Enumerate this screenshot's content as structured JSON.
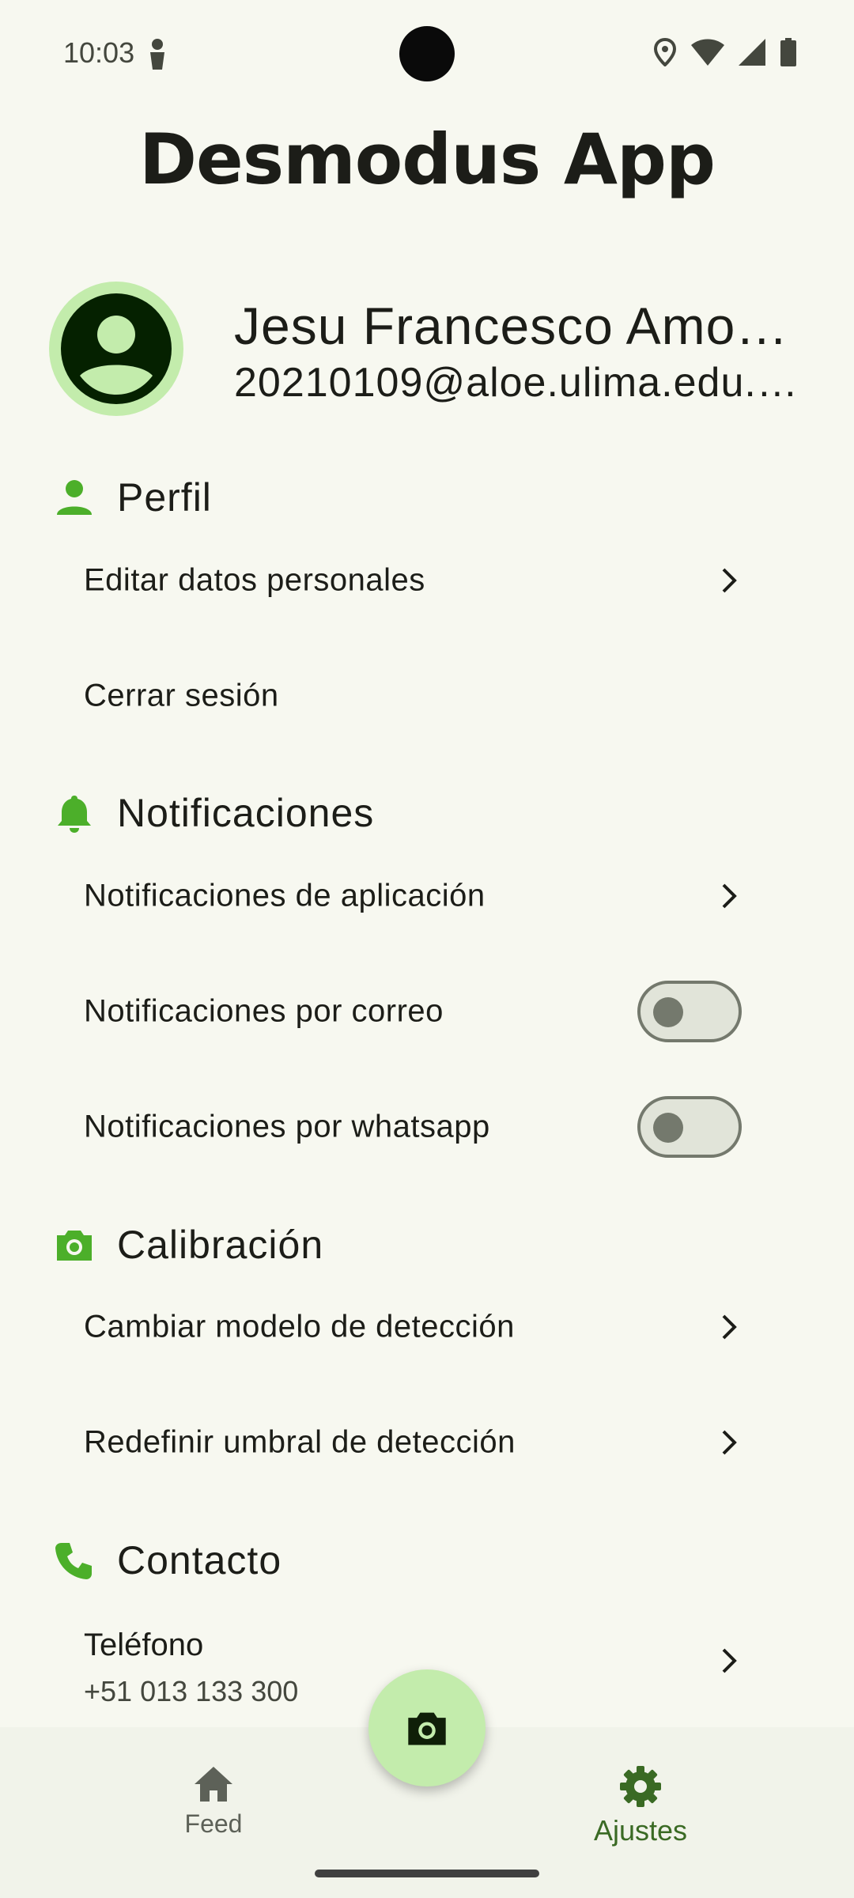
{
  "status_bar": {
    "time": "10:03"
  },
  "app": {
    "title": "Desmodus App"
  },
  "profile": {
    "name": "Jesu Francesco Amo…",
    "email": "20210109@aloe.ulima.edu.…"
  },
  "sections": {
    "perfil": {
      "title": "Perfil",
      "items": [
        "Editar datos personales",
        "Cerrar sesión"
      ]
    },
    "notificaciones": {
      "title": "Notificaciones",
      "items": [
        "Notificaciones de aplicación",
        "Notificaciones por correo",
        "Notificaciones por whatsapp"
      ],
      "toggles": {
        "correo": false,
        "whatsapp": false
      }
    },
    "calibracion": {
      "title": "Calibración",
      "items": [
        "Cambiar modelo de detección",
        "Redefinir umbral de detección"
      ]
    },
    "contacto": {
      "title": "Contacto",
      "phone_label": "Teléfono",
      "phone_value": "+51 013 133 300"
    }
  },
  "nav": {
    "feed": "Feed",
    "ajustes": "Ajustes",
    "active": "ajustes"
  },
  "icons": {
    "status": [
      "person-icon",
      "location-icon",
      "wifi-icon",
      "signal-icon",
      "battery-icon"
    ],
    "sections": [
      "person-icon",
      "bell-icon",
      "camera-icon",
      "phone-icon"
    ],
    "fab": "camera-icon",
    "nav": [
      "home-icon",
      "gear-icon"
    ]
  },
  "colors": {
    "accent_green": "#4caf2a",
    "fab_bg": "#c3ecac",
    "nav_active": "#3a6a24",
    "background": "#f7f8f0"
  }
}
